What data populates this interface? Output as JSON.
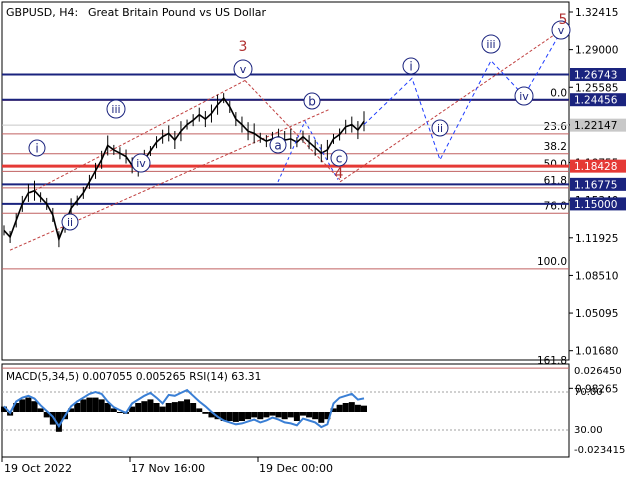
{
  "header": {
    "symbol": "GBPUSD, H4:",
    "description": "Great Britain Pound vs US Dollar"
  },
  "price_axis": {
    "ticks": [
      "1.32415",
      "1.29000",
      "1.25585",
      "1.22170",
      "1.18755",
      "1.15340",
      "1.11925",
      "1.08510",
      "1.05095",
      "1.01680",
      "0.98265"
    ]
  },
  "level_tags": [
    {
      "value": "1.26743",
      "color": "#1a237e"
    },
    {
      "value": "1.24456",
      "color": "#1a237e"
    },
    {
      "value": "1.22147",
      "color": "#c8c8c8"
    },
    {
      "value": "1.18428",
      "color": "#e53935"
    },
    {
      "value": "1.16775",
      "color": "#1a237e"
    },
    {
      "value": "1.15000",
      "color": "#1a237e"
    }
  ],
  "fib_levels": [
    {
      "label": "0.0",
      "price": 1.244
    },
    {
      "label": "23.6",
      "price": 1.2135
    },
    {
      "label": "38.2",
      "price": 1.1955
    },
    {
      "label": "50.0",
      "price": 1.1795
    },
    {
      "label": "61.8",
      "price": 1.1645
    },
    {
      "label": "76.0",
      "price": 1.1415
    },
    {
      "label": "100.0",
      "price": 1.091
    },
    {
      "label": "161.8",
      "price": 1.001
    }
  ],
  "wave_labels": {
    "w_i": "i",
    "w_ii": "ii",
    "w_iii": "iii",
    "w_iv": "iv",
    "w_v": "v",
    "w_3": "3",
    "w_4": "4",
    "w_5": "5",
    "w_a": "a",
    "w_b": "b",
    "w_c": "c",
    "f_i": "i",
    "f_ii": "ii",
    "f_iii": "iii",
    "f_iv": "iv",
    "f_v": "v"
  },
  "indicator": {
    "title": "MACD(5,34,5) 0.007055 0.005265 RSI(14) 63.31",
    "right_ticks": [
      "0.026450",
      "-0.023415"
    ],
    "left_levels": [
      "70.00",
      "30.00"
    ]
  },
  "time_axis": {
    "labels": [
      "19 Oct 2022",
      "17 Nov 16:00",
      "19 Dec 00:00"
    ]
  },
  "colors": {
    "price_line": "#000000",
    "wave_blue": "#1a237e",
    "wave_red": "#b03030",
    "fib_line": "#c06060",
    "rsi_line": "#3a7fd5",
    "macd_hist": "#000000"
  },
  "chart_data": {
    "type": "line",
    "title": "GBPUSD, H4: Great Britain Pound vs US Dollar",
    "x_labels": [
      "19 Oct 2022",
      "17 Nov 16:00",
      "19 Dec 00:00"
    ],
    "ylim": [
      0.965,
      1.34
    ],
    "series": [
      {
        "name": "GBPUSD",
        "values": [
          1.126,
          1.12,
          1.135,
          1.15,
          1.16,
          1.162,
          1.156,
          1.15,
          1.14,
          1.118,
          1.132,
          1.146,
          1.153,
          1.16,
          1.17,
          1.18,
          1.19,
          1.203,
          1.199,
          1.196,
          1.193,
          1.185,
          1.183,
          1.19,
          1.198,
          1.206,
          1.211,
          1.214,
          1.208,
          1.216,
          1.222,
          1.226,
          1.231,
          1.227,
          1.232,
          1.24,
          1.246,
          1.238,
          1.227,
          1.222,
          1.216,
          1.214,
          1.21,
          1.207,
          1.209,
          1.211,
          1.208,
          1.209,
          1.206,
          1.211,
          1.206,
          1.201,
          1.196,
          1.199,
          1.209,
          1.213,
          1.22,
          1.222,
          1.217,
          1.225
        ]
      },
      {
        "name": "RSI(14)",
        "values": [
          55,
          48,
          60,
          64,
          66,
          63,
          56,
          50,
          44,
          34,
          45,
          55,
          60,
          64,
          68,
          70,
          68,
          60,
          54,
          51,
          48,
          58,
          62,
          66,
          69,
          64,
          58,
          67,
          66,
          69,
          72,
          66,
          60,
          55,
          49,
          44,
          40,
          38,
          36,
          37,
          39,
          41,
          38,
          40,
          43,
          41,
          38,
          37,
          35,
          42,
          40,
          38,
          33,
          36,
          58,
          64,
          66,
          68,
          62,
          63.31
        ]
      },
      {
        "name": "MACD histogram",
        "values": [
          0.006,
          -0.004,
          0.01,
          0.014,
          0.016,
          0.012,
          0.004,
          -0.006,
          -0.014,
          -0.022,
          -0.008,
          0.004,
          0.01,
          0.014,
          0.016,
          0.016,
          0.014,
          0.01,
          0.004,
          0.0,
          -0.002,
          0.006,
          0.01,
          0.012,
          0.014,
          0.01,
          0.006,
          0.01,
          0.011,
          0.012,
          0.014,
          0.01,
          0.004,
          -0.002,
          -0.006,
          -0.008,
          -0.01,
          -0.01,
          -0.011,
          -0.01,
          -0.008,
          -0.006,
          -0.008,
          -0.006,
          -0.004,
          -0.006,
          -0.008,
          -0.006,
          -0.01,
          -0.004,
          -0.006,
          -0.008,
          -0.012,
          -0.008,
          0.004,
          0.008,
          0.01,
          0.011,
          0.008,
          0.007055
        ]
      }
    ]
  }
}
